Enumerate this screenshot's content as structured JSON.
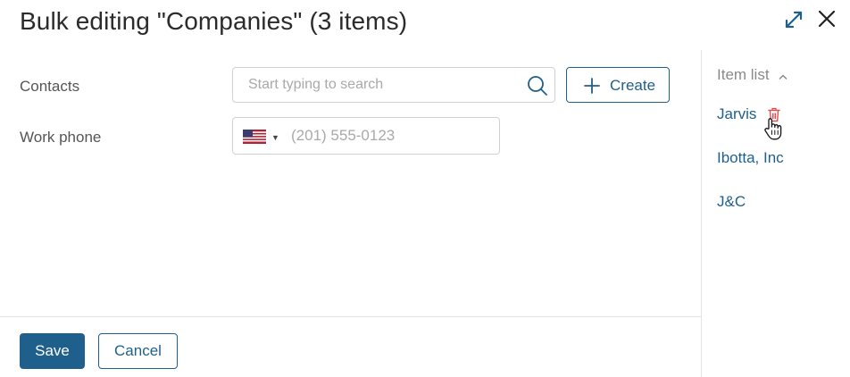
{
  "dialog": {
    "title": "Bulk editing \"Companies\" (3 items)"
  },
  "header_icons": {
    "expand": "expand-arrows-icon",
    "close": "close-x-icon"
  },
  "form": {
    "contacts": {
      "label": "Contacts",
      "placeholder": "Start typing to search",
      "value": "",
      "search_icon": "search-icon",
      "create_label": "Create"
    },
    "work_phone": {
      "label": "Work phone",
      "country_flag": "us-flag-icon",
      "placeholder": "(201) 555-0123",
      "value": ""
    }
  },
  "footer": {
    "save_label": "Save",
    "cancel_label": "Cancel"
  },
  "item_list": {
    "header": "Item list",
    "items": [
      "Jarvis",
      "Ibotta, Inc",
      "J&C"
    ]
  },
  "colors": {
    "accent": "#1f5f8b",
    "delete": "#e05050",
    "divider": "#e3e3e3"
  }
}
